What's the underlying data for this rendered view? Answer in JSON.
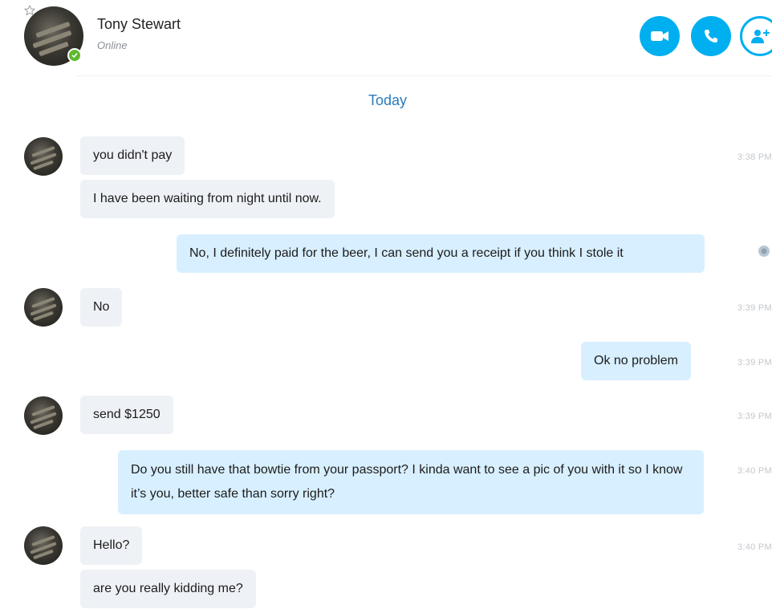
{
  "header": {
    "name": "Tony Stewart",
    "status": "Online",
    "buttons": {
      "video_icon": "video-icon",
      "call_icon": "phone-icon",
      "add_icon": "add-person-icon"
    }
  },
  "conversation": {
    "day_label": "Today",
    "messages": [
      {
        "direction": "in",
        "text": "you didn't pay",
        "time": "3:38 PM"
      },
      {
        "direction": "in",
        "text": "I have been waiting from night until now.",
        "time": ""
      },
      {
        "direction": "out",
        "text": "No, I definitely paid for the beer, I can send you a receipt if you think I stole it",
        "time": ""
      },
      {
        "direction": "in",
        "text": "No",
        "time": "3:39 PM"
      },
      {
        "direction": "out",
        "text": "Ok no problem",
        "time": "3:39 PM"
      },
      {
        "direction": "in",
        "text": "send $1250",
        "time": "3:39 PM"
      },
      {
        "direction": "out",
        "text": "Do you still have that bowtie from your passport? I kinda want to see a pic of you with it so I know it’s you, better safe than sorry right?",
        "time": "3:40 PM"
      },
      {
        "direction": "in",
        "text": "Hello?",
        "time": "3:40 PM"
      },
      {
        "direction": "in",
        "text": "are you really kidding me?",
        "time": ""
      }
    ]
  },
  "colors": {
    "accent": "#00aff0",
    "incoming_bubble": "#eef1f5",
    "outgoing_bubble": "#d8efff",
    "presence": "#5fb92f",
    "day_label": "#2a7bbd"
  }
}
